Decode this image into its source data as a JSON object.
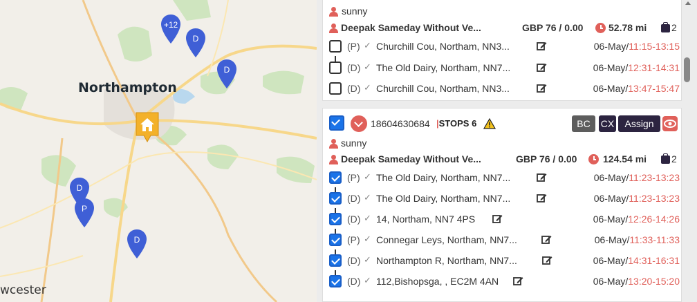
{
  "map": {
    "town_main": "Northampton",
    "town_small": "wcester",
    "pins": [
      {
        "label": "+12",
        "color": "#3f5fd6"
      },
      {
        "label": "D",
        "color": "#3f5fd6"
      },
      {
        "label": "D",
        "color": "#3f5fd6"
      },
      {
        "label": "D",
        "color": "#3f5fd6"
      },
      {
        "label": "P",
        "color": "#3f5fd6"
      },
      {
        "label": "D",
        "color": "#3f5fd6"
      }
    ],
    "home_icon": "home-icon",
    "home_color": "#f3b12a"
  },
  "orders": [
    {
      "user": "sunny",
      "service": "Deepak Sameday Without Ve...",
      "price": "GBP 76 / 0.00",
      "distance": "52.78 mi",
      "bags": "2",
      "stops": [
        {
          "type": "(P)",
          "address": "Churchill Cou, Northam, NN3...",
          "date": "06-May/",
          "time": "11:15-13:15",
          "checked": false
        },
        {
          "type": "(D)",
          "address": "The Old Dairy, Northam, NN7...",
          "date": "06-May/",
          "time": "12:31-14:31",
          "checked": false
        },
        {
          "type": "(D)",
          "address": "Churchill Cou, Northam, NN3...",
          "date": "06-May/",
          "time": "13:47-15:47",
          "checked": false
        }
      ]
    },
    {
      "order_id": "18604630684",
      "stops_separator": "|",
      "stops_label": "STOPS 6",
      "buttons": {
        "bc": "BC",
        "cx": "CX",
        "assign": "Assign"
      },
      "user": "sunny",
      "service": "Deepak Sameday Without Ve...",
      "price": "GBP 76 / 0.00",
      "distance": "124.54 mi",
      "bags": "2",
      "stops": [
        {
          "type": "(P)",
          "address": "The Old Dairy, Northam, NN7...",
          "date": "06-May/",
          "time": "11:23-13:23",
          "checked": true
        },
        {
          "type": "(D)",
          "address": "The Old Dairy, Northam, NN7...",
          "date": "06-May/",
          "time": "11:23-13:23",
          "checked": true
        },
        {
          "type": "(D)",
          "address": "14, Northam, NN7 4PS",
          "date": "06-May/",
          "time": "12:26-14:26",
          "checked": true
        },
        {
          "type": "(P)",
          "address": "Connegar Leys, Northam, NN7...",
          "date": "06-May/",
          "time": "11:33-11:33",
          "checked": true
        },
        {
          "type": "(D)",
          "address": "Northampton R, Northam, NN7...",
          "date": "06-May/",
          "time": "14:31-16:31",
          "checked": true
        },
        {
          "type": "(D)",
          "address": "112,Bishopsga, , EC2M 4AN",
          "date": "06-May/",
          "time": "13:20-15:20",
          "checked": true
        }
      ]
    }
  ],
  "colors": {
    "accent": "#e0605a",
    "dark": "#2c2440",
    "check_blue": "#1a73e8"
  }
}
